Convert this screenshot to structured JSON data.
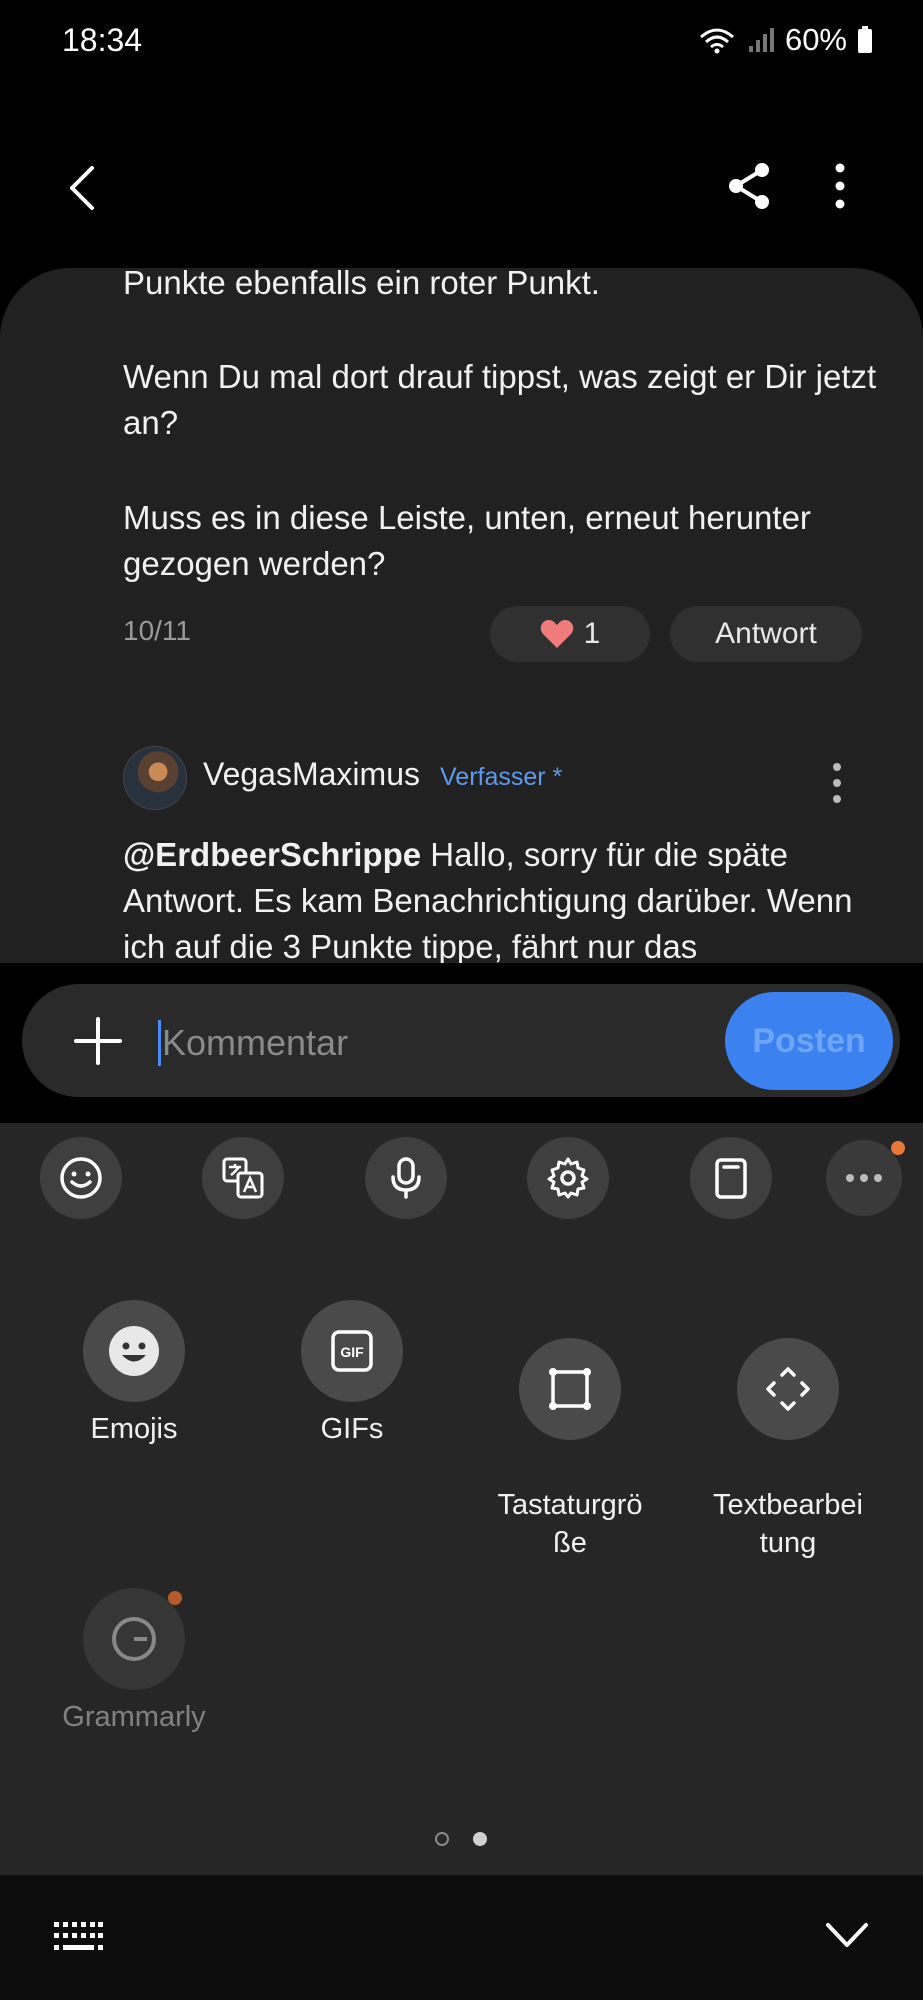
{
  "status_bar": {
    "time": "18:34",
    "battery": "60%"
  },
  "post": {
    "paragraphs": [
      "Punkte ebenfalls ein roter Punkt.",
      "Wenn Du mal dort drauf tippst, was zeigt er Dir jetzt an?",
      "Muss es in diese Leiste, unten, erneut herunter gezogen werden?"
    ],
    "date": "10/11",
    "likes": "1",
    "reply_label": "Antwort"
  },
  "comment": {
    "username": "VegasMaximus",
    "author_tag": "Verfasser *",
    "mention": "@ErdbeerSchrippe",
    "text": " Hallo, sorry für die späte Antwort. Es kam Benachrichtigung darüber. Wenn ich auf die 3 Punkte tippe, fährt nur das"
  },
  "input": {
    "placeholder": "Kommentar",
    "post_label": "Posten"
  },
  "keyboard": {
    "toolbar": [
      "emoji-icon",
      "translate-icon",
      "microphone-icon",
      "gear-icon",
      "clipboard-icon",
      "more-icon"
    ],
    "options": [
      {
        "label": "Emojis",
        "icon": "emoji-face-icon"
      },
      {
        "label": "GIFs",
        "icon": "gif-icon"
      },
      {
        "label": "Tastaturgrö\nße",
        "icon": "keyboard-size-icon"
      },
      {
        "label": "Textbearbei\ntung",
        "icon": "text-edit-icon"
      },
      {
        "label": "Grammarly",
        "icon": "grammarly-icon"
      }
    ],
    "page_indicator": {
      "current": 2,
      "total": 2
    }
  },
  "colors": {
    "accent": "#3b82f0",
    "author_tag": "#5e9bf0",
    "heart": "#f07b7b",
    "notify": "#e8773a"
  }
}
